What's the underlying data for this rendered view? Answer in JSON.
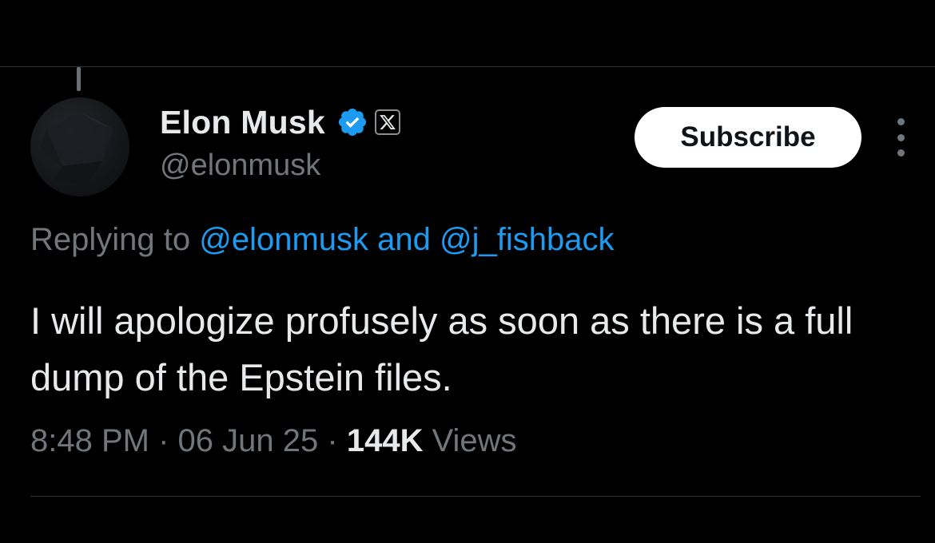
{
  "author": {
    "display_name": "Elon Musk",
    "handle": "@elonmusk",
    "verified_icon": "verified-badge-icon",
    "affiliation_icon": "x-logo-icon",
    "avatar": "avatar"
  },
  "header": {
    "subscribe_label": "Subscribe",
    "more_icon": "more-dots-icon"
  },
  "reply_context": {
    "prefix": "Replying to",
    "mention_1": "@elonmusk",
    "joiner": "and",
    "mention_2": "@j_fishback"
  },
  "tweet": {
    "text": "I will apologize profusely as soon as there is a full dump of the Epstein files."
  },
  "meta": {
    "time": "8:48 PM",
    "separator": "·",
    "date": "06 Jun 25",
    "views_count": "144K",
    "views_label": "Views"
  },
  "colors": {
    "background": "#000000",
    "primary_text": "#e7e9ea",
    "secondary_text": "#71767b",
    "link": "#1d9bf0",
    "verified": "#1d9bf0",
    "divider": "#2f3336"
  }
}
